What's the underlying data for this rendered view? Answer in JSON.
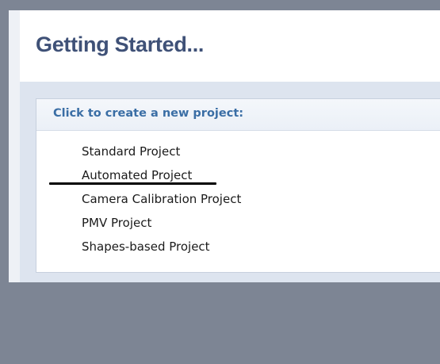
{
  "header": {
    "title": "Getting Started..."
  },
  "panel": {
    "title": "Click to create a new project:",
    "projects": [
      "Standard Project",
      "Automated Project",
      "Camera Calibration Project",
      "PMV Project",
      "Shapes-based Project"
    ]
  },
  "colors": {
    "title": "#3f5177",
    "panel_title": "#3a6ea5",
    "content_background": "#dde4ef",
    "frame": "#7d8594"
  }
}
